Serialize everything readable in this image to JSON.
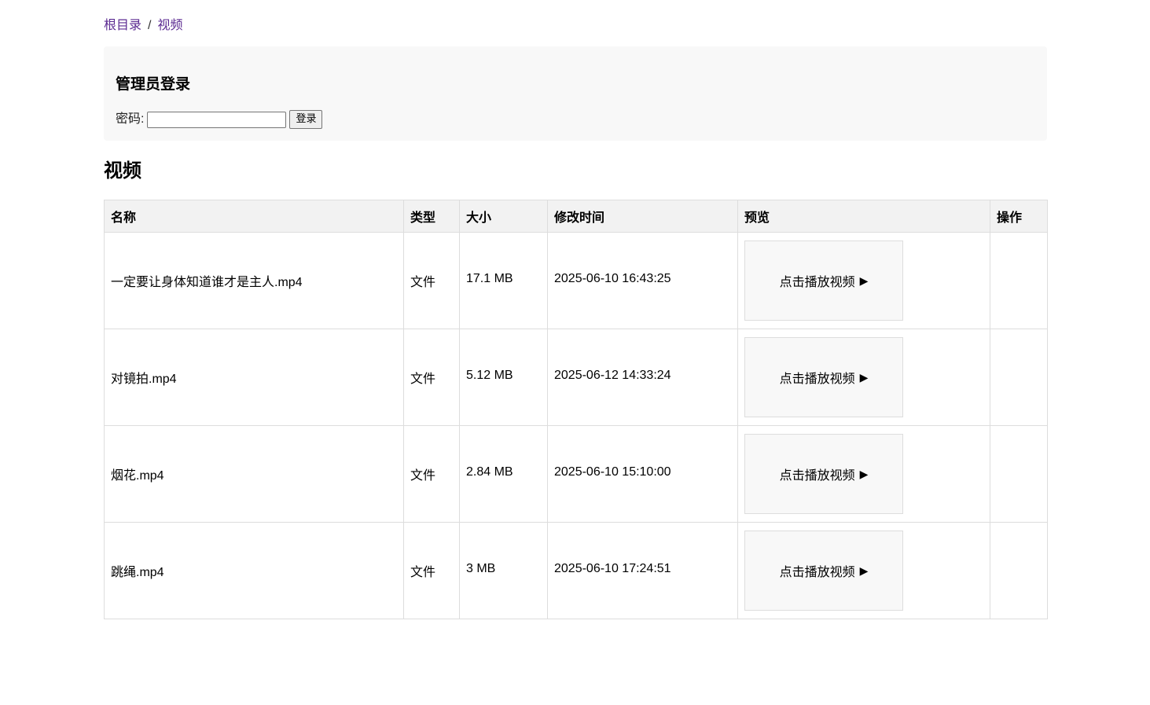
{
  "breadcrumb": {
    "root": "根目录",
    "separator": "/",
    "current": "视频"
  },
  "login": {
    "title": "管理员登录",
    "password_label": "密码:",
    "password_value": "",
    "button_label": "登录"
  },
  "section": {
    "title": "视频"
  },
  "table": {
    "headers": [
      "名称",
      "类型",
      "大小",
      "修改时间",
      "预览",
      "操作"
    ],
    "rows": [
      {
        "name": "一定要让身体知道谁才是主人.mp4",
        "type": "文件",
        "size": "17.1 MB",
        "modified": "2025-06-10 16:43:25",
        "preview_label": "点击播放视频",
        "actions": ""
      },
      {
        "name": "对镜拍.mp4",
        "type": "文件",
        "size": "5.12 MB",
        "modified": "2025-06-12 14:33:24",
        "preview_label": "点击播放视频",
        "actions": ""
      },
      {
        "name": "烟花.mp4",
        "type": "文件",
        "size": "2.84 MB",
        "modified": "2025-06-10 15:10:00",
        "preview_label": "点击播放视频",
        "actions": ""
      },
      {
        "name": "跳绳.mp4",
        "type": "文件",
        "size": "3 MB",
        "modified": "2025-06-10 17:24:51",
        "preview_label": "点击播放视频",
        "actions": ""
      }
    ]
  },
  "icons": {
    "play": "play-icon"
  },
  "colors": {
    "link": "#5b2a91",
    "panel_bg": "#f8f8f8",
    "header_bg": "#f2f2f2",
    "border": "#dddddd"
  }
}
